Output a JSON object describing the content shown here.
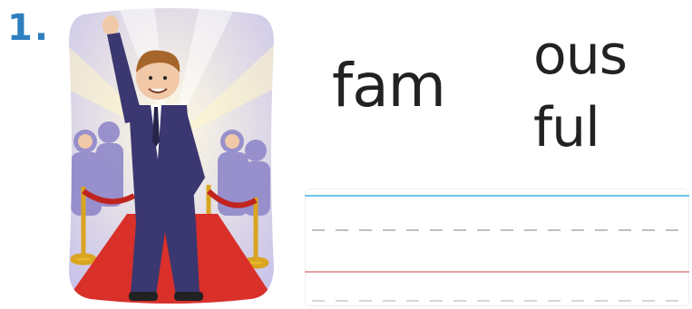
{
  "worksheet": {
    "item_number": "1.",
    "illustration_icon": "celebrity-waving-on-red-carpet",
    "syllables": {
      "first": "fam",
      "option_top": "ous",
      "option_bottom": "ful"
    },
    "writing_lines": "handwriting-practice-lines",
    "colors": {
      "number": "#2e7fc0",
      "top_line": "#6fc3ea",
      "base_line": "#e9a0a8",
      "dashed_line": "#bfbfbf",
      "carpet": "#d9302a"
    }
  }
}
